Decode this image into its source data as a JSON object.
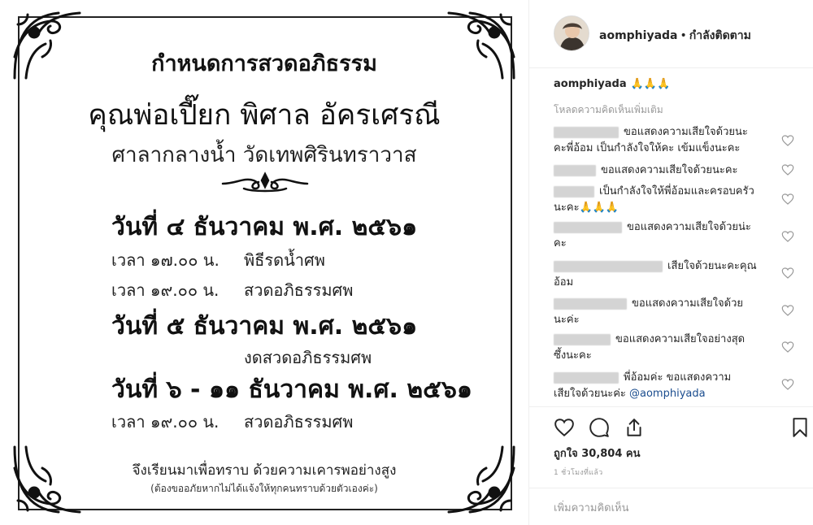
{
  "notice": {
    "heading": "กำหนดการสวดอภิธรรม",
    "name": "คุณพ่อเปี๊ยก พิศาล อัครเศรณี",
    "place": "ศาลากลางน้ำ วัดเทพศิรินทราวาส",
    "day1": {
      "date": "วันที่ ๔ ธันวาคม พ.ศ. ๒๕๖๑",
      "time1": "เวลา ๑๗.๐๐ น.",
      "act1": "พิธีรดน้ำศพ",
      "time2": "เวลา ๑๙.๐๐ น.",
      "act2": "สวดอภิธรรมศพ"
    },
    "day2": {
      "date": "วันที่ ๕ ธันวาคม พ.ศ. ๒๕๖๑",
      "act": "งดสวดอภิธรรมศพ"
    },
    "day3": {
      "date": "วันที่ ๖ - ๑๑ ธันวาคม พ.ศ. ๒๕๖๑",
      "time": "เวลา ๑๙.๐๐ น.",
      "act": "สวดอภิธรรมศพ"
    },
    "footer1": "จึงเรียนมาเพื่อทราบ ด้วยความเคารพอย่างสูง",
    "footer2": "(ต้องขออภัยหากไม่ได้แจ้งให้ทุกคนทราบด้วยตัวเองค่ะ)"
  },
  "header": {
    "username": "aomphiyada",
    "separator": "•",
    "follow_status": "กำลังติดตาม"
  },
  "caption": {
    "username": "aomphiyada",
    "text": "🙏🙏🙏"
  },
  "load_more": "โหลดความคิดเห็นเพิ่มเติม",
  "comments": [
    {
      "line1": "ขอแสดงความเสียใจด้วยนะ",
      "line2": "คะพี่อ้อม เป็นกำลังใจให้คะ เข้มแข็งนะคะ"
    },
    {
      "line1": "ขอแสดงความเสียใจด้วยนะคะ",
      "line2": ""
    },
    {
      "line1": "เป็นกำลังใจให้พี่อ้อมและครอบครัว",
      "line2": "นะคะ🙏🙏🙏"
    },
    {
      "line1": "ขอแสดงความเสียใจด้วยน่ะ",
      "line2": "คะ"
    },
    {
      "line1": "เสียใจด้วยนะคะคุณ",
      "line2": "อ้อม"
    },
    {
      "line1": "ขอแสดงความเสียใจด้วย",
      "line2": "นะค่ะ"
    },
    {
      "line1": "ขอแสดงความเสียใจอย่างสุด",
      "line2": "ซึ้งนะคะ"
    },
    {
      "line1": "พี่อ้อมค่ะ ขอแสดงความ",
      "line2": "เสียใจด้วยนะค่ะ",
      "mention": "@aomphiyada"
    }
  ],
  "likes": "ถูกใจ 30,804 คน",
  "time_ago": "1 ชั่วโมงที่แล้ว",
  "add_comment_placeholder": "เพิ่มความคิดเห็น"
}
